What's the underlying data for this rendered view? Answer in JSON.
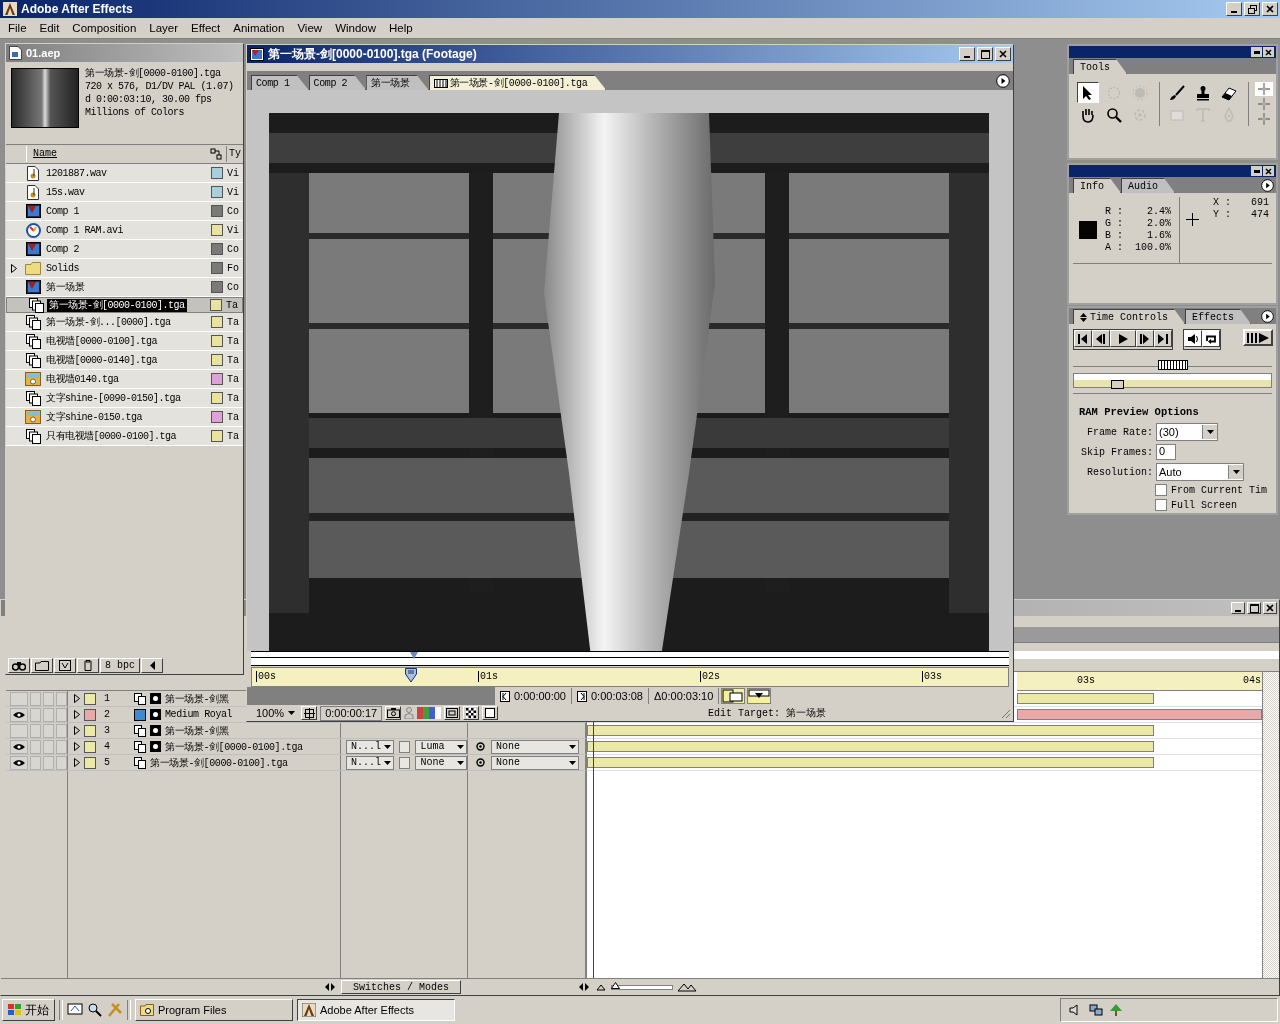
{
  "app": {
    "title": "Adobe After Effects"
  },
  "menu": [
    "File",
    "Edit",
    "Composition",
    "Layer",
    "Effect",
    "Animation",
    "View",
    "Window",
    "Help"
  ],
  "project": {
    "title": "01.aep",
    "preview": {
      "name": "第一场景-剑[0000-0100].tga",
      "lines": [
        "720 x 576, D1/DV PAL (1.07)",
        "d 0:00:03:10, 30.00 fps",
        "Millions of Colors"
      ]
    },
    "columns": [
      "Name",
      "Ty"
    ],
    "items": [
      {
        "kind": "audio",
        "name": "1201887.wav",
        "color": "#a8d0dc",
        "type": "Vi",
        "selected": false
      },
      {
        "kind": "audio",
        "name": "15s.wav",
        "color": "#a8d0dc",
        "type": "Vi",
        "selected": false
      },
      {
        "kind": "comp",
        "name": "Comp 1",
        "color": "#7a7a7a",
        "type": "Co",
        "selected": false
      },
      {
        "kind": "movie",
        "name": "Comp 1 RAM.avi",
        "color": "#e8e4a0",
        "type": "Vi",
        "selected": false
      },
      {
        "kind": "comp",
        "name": "Comp 2",
        "color": "#7a7a7a",
        "type": "Co",
        "selected": false
      },
      {
        "kind": "folder",
        "name": "Solids",
        "color": "#7a7a7a",
        "type": "Fo",
        "selected": false,
        "expanded": false
      },
      {
        "kind": "comp",
        "name": "第一场景",
        "color": "#7a7a7a",
        "type": "Co",
        "selected": false
      },
      {
        "kind": "sequence",
        "name": "第一场景-剑[0000-0100].tga",
        "color": "#e8e4a0",
        "type": "Ta",
        "selected": true
      },
      {
        "kind": "sequence",
        "name": "第一场景-剑...[0000].tga",
        "color": "#e8e4a0",
        "type": "Ta",
        "selected": false
      },
      {
        "kind": "sequence",
        "name": "电视墙[0000-0100].tga",
        "color": "#e8e4a0",
        "type": "Ta",
        "selected": false
      },
      {
        "kind": "sequence",
        "name": "电视墙[0000-0140].tga",
        "color": "#e8e4a0",
        "type": "Ta",
        "selected": false
      },
      {
        "kind": "still",
        "name": "电视墙0140.tga",
        "color": "#e0a0d8",
        "type": "Ta",
        "selected": false
      },
      {
        "kind": "sequence",
        "name": "文字shine-[0090-0150].tga",
        "color": "#e8e4a0",
        "type": "Ta",
        "selected": false
      },
      {
        "kind": "still",
        "name": "文字shine-0150.tga",
        "color": "#e0a0d8",
        "type": "Ta",
        "selected": false
      },
      {
        "kind": "sequence",
        "name": "只有电视墙[0000-0100].tga",
        "color": "#e8e4a0",
        "type": "Ta",
        "selected": false
      }
    ],
    "depth": "8 bpc"
  },
  "footage": {
    "title": "第一场景-剑[0000-0100].tga (Footage)",
    "tabs": [
      {
        "label": "Comp 1",
        "selected": false
      },
      {
        "label": "Comp 2",
        "selected": false
      },
      {
        "label": "第一场景",
        "selected": false
      },
      {
        "label": "第一场景-剑[0000-0100].tga",
        "selected": true
      }
    ],
    "ruler": [
      "00s",
      "01s",
      "02s",
      "03s"
    ],
    "playhead": {
      "level": 0.21
    },
    "in_point": "0:00:00:00",
    "out_point": "0:00:03:08",
    "duration": "Δ0:00:03:10",
    "magnification": "100%",
    "current_time": "0:00:00:17",
    "edit_target": "Edit Target: 第一场景"
  },
  "tools": {
    "title": "Tools",
    "items": [
      {
        "kind": "selection",
        "selected": true,
        "disabled": false
      },
      {
        "kind": "rotation",
        "selected": false,
        "disabled": true
      },
      {
        "kind": "orbit",
        "selected": false,
        "disabled": true
      },
      {
        "kind": "hand",
        "selected": false,
        "disabled": false
      },
      {
        "kind": "zoom",
        "selected": false,
        "disabled": false
      },
      {
        "kind": "pan-behind",
        "selected": false,
        "disabled": true
      },
      {
        "kind": "brush",
        "selected": false,
        "disabled": false
      },
      {
        "kind": "stamp",
        "selected": false,
        "disabled": false
      },
      {
        "kind": "eraser",
        "selected": false,
        "disabled": false
      },
      {
        "kind": "rectangle",
        "selected": false,
        "disabled": true
      },
      {
        "kind": "text",
        "selected": false,
        "disabled": true
      },
      {
        "kind": "pen",
        "selected": false,
        "disabled": true
      }
    ],
    "axis_modes": [
      {
        "selected": true
      },
      {
        "selected": false
      },
      {
        "selected": false
      }
    ]
  },
  "info": {
    "tabs": [
      {
        "label": "Info",
        "selected": true
      },
      {
        "label": "Audio",
        "selected": false
      }
    ],
    "channels": [
      {
        "label": "R :",
        "value": "2.4%"
      },
      {
        "label": "G :",
        "value": "2.0%"
      },
      {
        "label": "B :",
        "value": "1.6%"
      },
      {
        "label": "A :",
        "value": "100.0%"
      }
    ],
    "position": [
      {
        "label": "X :",
        "value": "691"
      },
      {
        "label": "Y :",
        "value": "474"
      }
    ]
  },
  "time_controls": {
    "tabs": [
      {
        "label": "Time Controls",
        "selected": true
      },
      {
        "label": "Effects",
        "selected": false
      }
    ],
    "toggles": [
      {
        "kind": "audio",
        "on": true
      },
      {
        "kind": "loop",
        "on": true
      }
    ],
    "level": 0.22,
    "heading": "RAM Preview Options",
    "fields": [
      {
        "kind": "select",
        "label": "Frame Rate:",
        "value": "(30)"
      },
      {
        "kind": "input",
        "label": "Skip Frames:",
        "value": "0"
      },
      {
        "kind": "select",
        "label": "Resolution:",
        "value": "Auto"
      }
    ],
    "options": [
      {
        "label": "From Current Tim",
        "checked": false
      },
      {
        "label": "Full Screen",
        "checked": false
      }
    ]
  },
  "timeline": {
    "ruler": [
      "03s",
      "04s"
    ],
    "layers": [
      {
        "number": "1",
        "name": "第一场景-剑黑",
        "kind": "footage",
        "matte": true,
        "color": "#ece8a8",
        "visible": false,
        "level": 0.84
      },
      {
        "number": "2",
        "name": "Medium Royal",
        "kind": "solid",
        "matte": true,
        "color": "#eaa8a8",
        "visible": true,
        "level": 1
      },
      {
        "number": "3",
        "name": "第一场景-剑黑",
        "kind": "footage",
        "matte": true,
        "color": "#ece8a8",
        "visible": false,
        "level": 0.84
      },
      {
        "number": "4",
        "name": "第一场景-剑[0000-0100].tga",
        "kind": "footage",
        "matte": true,
        "color": "#ece8a8",
        "visible": true,
        "mode": "N...l",
        "preserve_transparency": false,
        "trkmat": "Luma",
        "parent": "None",
        "level": 0.84
      },
      {
        "number": "5",
        "name": "第一场景-剑[0000-0100].tga",
        "kind": "footage",
        "matte": false,
        "color": "#ece8a8",
        "visible": true,
        "mode": "N...l",
        "preserve_transparency": false,
        "trkmat": "None",
        "parent": "None",
        "level": 0.84
      }
    ],
    "panel_toggle": "Switches / Modes",
    "zoom": {
      "level": 0.05
    }
  },
  "taskbar": {
    "start": "开始",
    "tasks": [
      {
        "label": "Program Files",
        "selected": false
      },
      {
        "label": "Adobe After Effects",
        "selected": true
      }
    ]
  }
}
